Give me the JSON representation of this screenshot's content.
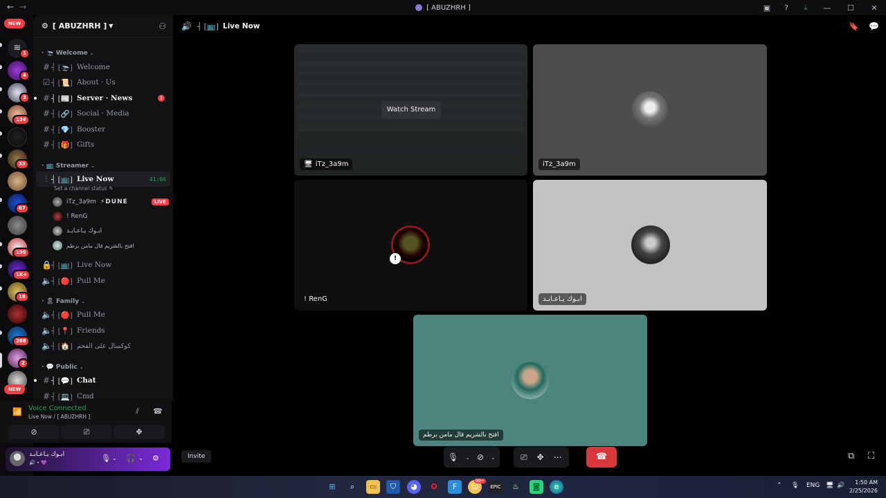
{
  "window": {
    "title": "[ ABUZHRH ]",
    "nav_back": "←",
    "nav_forward": "→"
  },
  "server": {
    "name": "[ ABUZHRH ]"
  },
  "rail": {
    "new_label_top": "NEW",
    "new_label_bottom": "NEW",
    "badges": [
      "3",
      "1",
      "4",
      "3",
      "134",
      "33",
      "67",
      "199",
      "1K+",
      "18",
      "288",
      "2"
    ]
  },
  "categories": {
    "welcome": "Welcome",
    "streamer": "Streamer",
    "family": "Family",
    "public": "Public"
  },
  "channels": {
    "welcome": "Welcome",
    "about": "About · Us",
    "news": "Server · News",
    "news_mentions": "1",
    "social": "Social · Media",
    "booster": "Booster",
    "gifts": "Gifts",
    "live_now": "Live Now",
    "live_timer": "41:06",
    "status_prompt": "Set a channel status",
    "live_now_2": "Live Now",
    "pull_me": "Pull Me",
    "family_pull_me": "Pull Me",
    "friends": "Friends",
    "arabic_channel": "كوكسال على الفحم",
    "chat": "Chat",
    "cmd": "Cmd"
  },
  "voice_users": [
    {
      "name": "iTz_3a9m",
      "tag": "⚡DUNE",
      "live": "LIVE"
    },
    {
      "name": "! RenG"
    },
    {
      "name": "ابـوك يـاعـابـد"
    },
    {
      "name": "افتح بالشريم قال مامن برطم"
    }
  ],
  "voice_panel": {
    "title": "Voice Connected",
    "subtitle": "Live Now / [ ABUZHRH ]"
  },
  "user_panel": {
    "name": "ابـوك يـاعـابـد"
  },
  "main": {
    "channel_title": "Live Now"
  },
  "tiles": [
    {
      "label": "iTz_3a9m",
      "button": "Watch Stream"
    },
    {
      "label": "iTz_3a9m"
    },
    {
      "label": "! RenG"
    },
    {
      "label": "ابـوك يـاعـابـد"
    },
    {
      "label": "افتح بالشريم قال مامن برطم"
    }
  ],
  "invite_label": "Invite",
  "taskbar": {
    "language": "ENG",
    "time": "1:50 AM",
    "date": "2/25/2026",
    "notification_badge": "99+"
  },
  "colors": {
    "online_green": "#23a559",
    "danger_red": "#da373c",
    "tile_teal": "#4c857d",
    "tile_gray": "#c3c3c1"
  }
}
